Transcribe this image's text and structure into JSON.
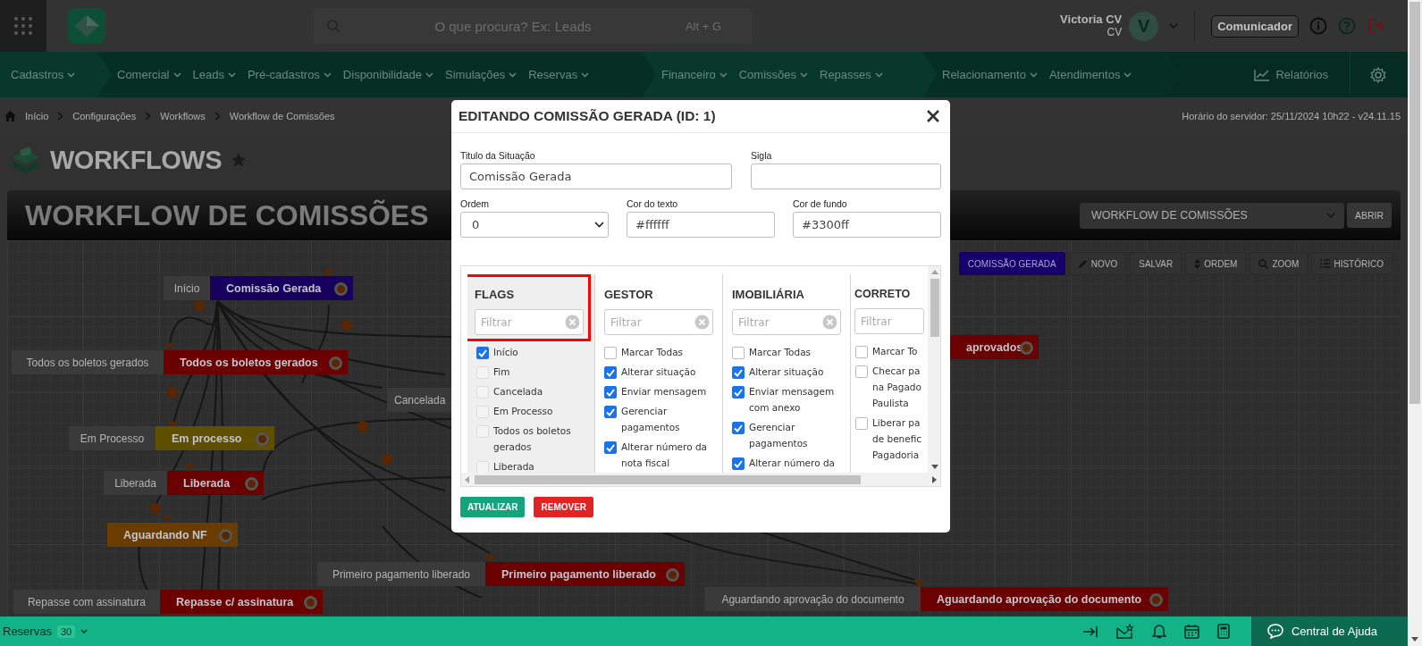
{
  "top_bar": {
    "search": {
      "placeholder": "O que procura? Ex: Leads",
      "shortcut": "Alt + G"
    },
    "user": {
      "name": "Victoria CV",
      "subtitle": "CV",
      "avatar": "V"
    },
    "communicator_button": "Comunicador"
  },
  "nav": {
    "groups": [
      {
        "items": [
          "Cadastros"
        ]
      },
      {
        "items": [
          "Comercial",
          "Leads",
          "Pré-cadastros",
          "Disponibilidade",
          "Simulações",
          "Reservas"
        ]
      },
      {
        "items": [
          "Financeiro",
          "Comissões",
          "Repasses"
        ]
      },
      {
        "items": [
          "Relacionamento",
          "Atendimentos"
        ]
      }
    ],
    "reports": "Relatórios"
  },
  "breadcrumb": [
    "Início",
    "Configurações",
    "Workflows",
    "Workflow de Comissões"
  ],
  "server_time": "Horário do servidor: 25/11/2024 10h22 - v24.11.15",
  "page_title": "WORKFLOWS",
  "workflow_header": {
    "title": "WORKFLOW DE COMISSÕES",
    "select": "WORKFLOW DE COMISSÕES",
    "open_button": "ABRIR"
  },
  "toolbar": [
    {
      "label": "COMISSÃO GERADA",
      "kind": "current"
    },
    {
      "label": "NOVO",
      "kind": "pencil"
    },
    {
      "label": "SALVAR",
      "kind": "plain"
    },
    {
      "label": "ORDEM",
      "kind": "sort"
    },
    {
      "label": "ZOOM",
      "kind": "zoom"
    },
    {
      "label": "HISTÓRICO",
      "kind": "list"
    }
  ],
  "canvas": {
    "nodes": [
      {
        "tag": "Início",
        "title": "Comissão Gerada",
        "color": "#17005e"
      },
      {
        "tag": "Todos os boletos gerados",
        "title": "Todos os boletos gerados",
        "color": "#6a0000"
      },
      {
        "tag": "Cancelada"
      },
      {
        "tag": "Em Processo",
        "title": "Em processo",
        "color": "#5e5000"
      },
      {
        "tag": "Liberada",
        "title": "Liberada",
        "color": "#6a0000"
      },
      {
        "title": "Aguardando NF",
        "color": "#6a3c00"
      },
      {
        "tag": "Primeiro pagamento liberado",
        "title": "Primeiro pagamento liberado",
        "color": "#6a0000"
      },
      {
        "tag": "Repasse com assinatura",
        "title": "Repasse c/ assinatura",
        "color": "#6a0000"
      },
      {
        "tag": "Aguardando aprovação do documento",
        "title": "Aguardando aprovação do documento",
        "color": "#6a0000"
      },
      {
        "title": "aprovados",
        "color": "#6a0000"
      }
    ]
  },
  "modal": {
    "title": "EDITANDO COMISSÃO GERADA (ID: 1)",
    "fields": {
      "title_label": "Titulo da Situação",
      "title_value": "Comissão Gerada",
      "acronym_label": "Sigla",
      "order_label": "Ordem",
      "order_value": "0",
      "text_color_label": "Cor do texto",
      "text_color_value": "#ffffff",
      "bg_color_label": "Cor de fundo",
      "bg_color_value": "#3300ff"
    },
    "columns": [
      {
        "title": "FLAGS",
        "highlighted": true,
        "filter_placeholder": "Filtrar",
        "clipped": false,
        "items": [
          {
            "label": "Início",
            "checked": true
          },
          {
            "label": "Fim",
            "checked": false
          },
          {
            "label": "Cancelada",
            "checked": false
          },
          {
            "label": "Em Processo",
            "checked": false
          },
          {
            "label": "Todos os boletos gerados",
            "checked": false
          },
          {
            "label": "Liberada",
            "checked": false
          }
        ]
      },
      {
        "title": "GESTOR",
        "highlighted": false,
        "filter_placeholder": "Filtrar",
        "clipped": false,
        "items": [
          {
            "label": "Marcar Todas",
            "checked": false
          },
          {
            "label": "Alterar situação",
            "checked": true
          },
          {
            "label": "Enviar mensagem",
            "checked": true
          },
          {
            "label": "Gerenciar pagamentos",
            "checked": true
          },
          {
            "label": "Alterar número da nota fiscal",
            "checked": true
          }
        ]
      },
      {
        "title": "IMOBILIÁRIA",
        "highlighted": false,
        "filter_placeholder": "Filtrar",
        "clipped": false,
        "items": [
          {
            "label": "Marcar Todas",
            "checked": false
          },
          {
            "label": "Alterar situação",
            "checked": true
          },
          {
            "label": "Enviar mensagem com anexo",
            "checked": true
          },
          {
            "label": "Gerenciar pagamentos",
            "checked": true
          },
          {
            "label": "Alterar número da",
            "checked": true
          }
        ]
      },
      {
        "title": "CORRETO",
        "highlighted": false,
        "filter_placeholder": "Filtrar",
        "clipped": true,
        "items": [
          {
            "label": "Marcar To",
            "checked": false
          },
          {
            "label": "Checar pa\nna Pagado\nPaulista",
            "checked": false
          },
          {
            "label": "Liberar pa\nde benefic\nPagadoria",
            "checked": false
          }
        ]
      }
    ],
    "buttons": [
      {
        "label": "ATUALIZAR",
        "kind": "primary"
      },
      {
        "label": "REMOVER",
        "kind": "danger"
      }
    ]
  },
  "footer": {
    "module": "Reservas",
    "count": "30",
    "help": "Central de Ajuda"
  }
}
